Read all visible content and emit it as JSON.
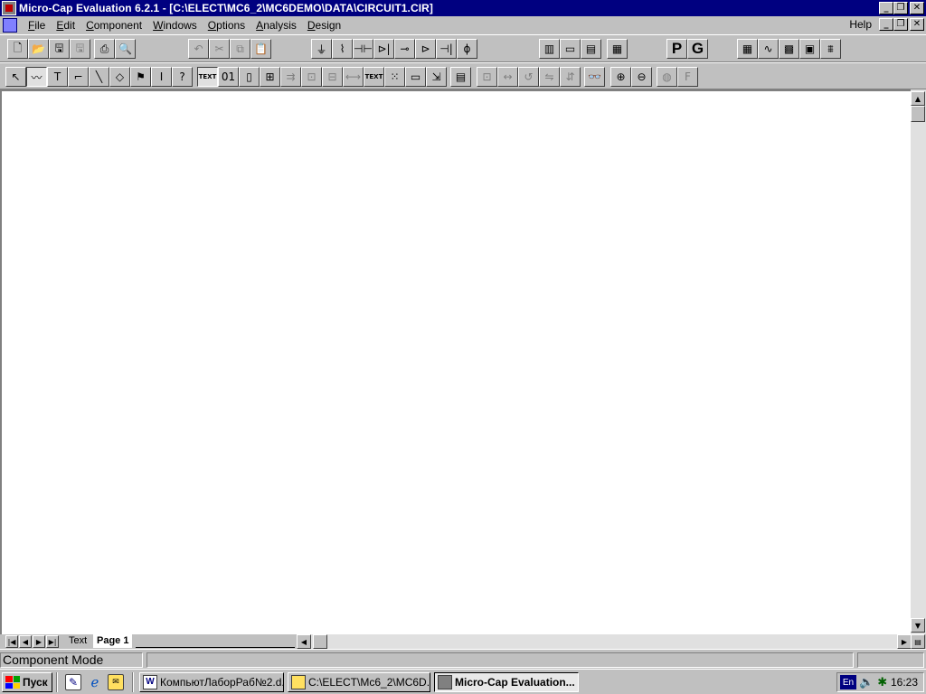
{
  "window": {
    "title": "Micro-Cap Evaluation 6.2.1 - [C:\\ELECT\\MC6_2\\MC6DEMO\\DATA\\CIRCUIT1.CIR]",
    "minimize_glyph": "_",
    "restore_glyph": "❐",
    "close_glyph": "✕"
  },
  "menubar": {
    "items": [
      "File",
      "Edit",
      "Component",
      "Windows",
      "Options",
      "Analysis",
      "Design"
    ],
    "help": "Help"
  },
  "toolbar1": {
    "buttons": [
      {
        "name": "new-file-icon",
        "glyph": "🗋"
      },
      {
        "name": "open-folder-icon",
        "glyph": "📂"
      },
      {
        "name": "save-icon",
        "glyph": "🖫"
      },
      {
        "name": "save-all-icon",
        "glyph": "🖫"
      },
      {
        "name": "print-icon",
        "glyph": "⎙"
      },
      {
        "name": "print-preview-icon",
        "glyph": "🔍"
      },
      {
        "name": "undo-icon",
        "glyph": "↶"
      },
      {
        "name": "cut-icon",
        "glyph": "✂"
      },
      {
        "name": "copy-icon",
        "glyph": "⧉"
      },
      {
        "name": "paste-icon",
        "glyph": "📋"
      },
      {
        "name": "ground-icon",
        "glyph": "⏚"
      },
      {
        "name": "resistor-icon",
        "glyph": "⌇"
      },
      {
        "name": "capacitor-icon",
        "glyph": "⊣⊢"
      },
      {
        "name": "diode-icon",
        "glyph": "⊳|"
      },
      {
        "name": "inductor-icon",
        "glyph": "⊸"
      },
      {
        "name": "transistor-icon",
        "glyph": "⊳"
      },
      {
        "name": "battery-icon",
        "glyph": "⊣|"
      },
      {
        "name": "source-icon",
        "glyph": "ϕ"
      },
      {
        "name": "tile-vertical-icon",
        "glyph": "▥"
      },
      {
        "name": "maximize-window-icon",
        "glyph": "▭"
      },
      {
        "name": "cascade-icon",
        "glyph": "▤"
      },
      {
        "name": "calculator-icon",
        "glyph": "▦"
      },
      {
        "name": "probe-p-button",
        "glyph": "P"
      },
      {
        "name": "probe-g-button",
        "glyph": "G"
      },
      {
        "name": "table-icon",
        "glyph": "▦"
      },
      {
        "name": "wave-icon",
        "glyph": "∿"
      },
      {
        "name": "plot-icon",
        "glyph": "▩"
      },
      {
        "name": "grid-icon",
        "glyph": "▣"
      },
      {
        "name": "scope-icon",
        "glyph": "⩩"
      }
    ]
  },
  "toolbar2": {
    "buttons": [
      {
        "name": "select-arrow-icon",
        "glyph": "↖"
      },
      {
        "name": "wire-mode-icon",
        "glyph": "〰"
      },
      {
        "name": "text-tool-icon",
        "glyph": "T"
      },
      {
        "name": "orthogonal-wire-icon",
        "glyph": "⌐"
      },
      {
        "name": "diagonal-wire-icon",
        "glyph": "╲"
      },
      {
        "name": "shapes-icon",
        "glyph": "◇"
      },
      {
        "name": "flag-icon",
        "glyph": "⚑"
      },
      {
        "name": "info-icon",
        "glyph": "I"
      },
      {
        "name": "help-cursor-icon",
        "glyph": "?"
      },
      {
        "name": "text-button",
        "glyph": "TEXT"
      },
      {
        "name": "node-numbers-icon",
        "glyph": "01"
      },
      {
        "name": "attribute-icon",
        "glyph": "▯"
      },
      {
        "name": "pin-names-icon",
        "glyph": "⊞"
      },
      {
        "name": "pin-icon",
        "glyph": "⇉"
      },
      {
        "name": "component-text-icon",
        "glyph": "⊡"
      },
      {
        "name": "node-voltage-icon",
        "glyph": "⊟"
      },
      {
        "name": "wire-icon",
        "glyph": "⟷"
      },
      {
        "name": "grid-text-button",
        "glyph": "TEXT"
      },
      {
        "name": "grid-dots-icon",
        "glyph": "⁙"
      },
      {
        "name": "page-scale-icon",
        "glyph": "▭"
      },
      {
        "name": "cursor-probe-icon",
        "glyph": "⇲"
      },
      {
        "name": "properties-icon",
        "glyph": "▤"
      },
      {
        "name": "rotate-icon",
        "glyph": "⊡"
      },
      {
        "name": "mirror-icon",
        "glyph": "↔"
      },
      {
        "name": "step-icon",
        "glyph": "↺"
      },
      {
        "name": "flip-x-icon",
        "glyph": "⇋"
      },
      {
        "name": "flip-y-icon",
        "glyph": "⇵"
      },
      {
        "name": "find-binoculars-icon",
        "glyph": "👓"
      },
      {
        "name": "zoom-in-icon",
        "glyph": "⊕"
      },
      {
        "name": "zoom-out-icon",
        "glyph": "⊖"
      },
      {
        "name": "globe-icon",
        "glyph": "◍"
      },
      {
        "name": "font-icon",
        "glyph": "F"
      }
    ]
  },
  "tabs": {
    "text": "Text",
    "page1": "Page 1"
  },
  "status": {
    "mode": "Component Mode"
  },
  "taskbar": {
    "start": "Пуск",
    "tasks": [
      {
        "label": "КомпьютЛаборРаб№2.d..."
      },
      {
        "label": "C:\\ELECT\\Mc6_2\\MC6D..."
      },
      {
        "label": "Micro-Cap Evaluation..."
      }
    ],
    "lang": "En",
    "clock": "16:23"
  },
  "colors": {
    "titlebar": "#000080",
    "face": "#c0c0c0",
    "canvas": "#ffffff"
  }
}
